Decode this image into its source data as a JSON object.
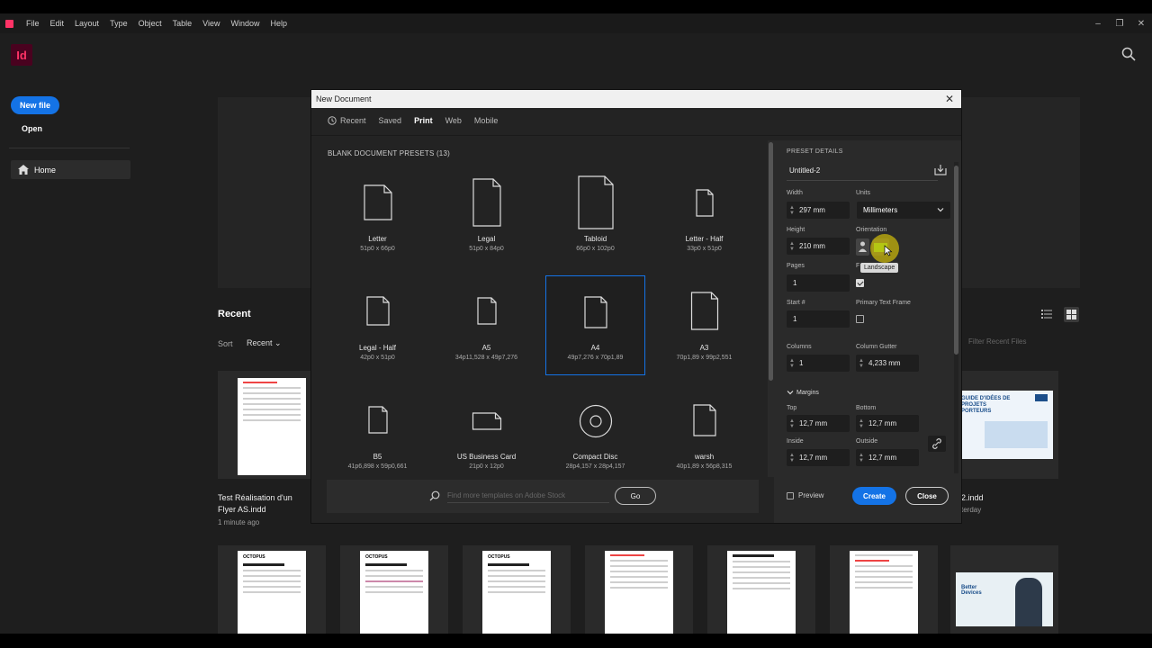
{
  "menubar": {
    "items": [
      "File",
      "Edit",
      "Layout",
      "Type",
      "Object",
      "Table",
      "View",
      "Window",
      "Help"
    ]
  },
  "appbar": {
    "logo": "Id"
  },
  "sidebar": {
    "new_file": "New file",
    "open": "Open",
    "home": "Home"
  },
  "home": {
    "recent_title": "Recent",
    "sort_label": "Sort",
    "sort_value": "Recent",
    "filter_placeholder": "Filter Recent Files",
    "files": [
      {
        "name": "Test Réalisation d'un Flyer AS.indd",
        "time": "1 minute ago"
      },
      {
        "name": "2.indd",
        "time": "terday"
      }
    ],
    "right_thumb_text": "GUIDE D'IDÉES DE PROJETS PORTEURS",
    "bottom_thumb_label": "Better Devices",
    "doc_headers": [
      "OCTOPUS",
      "OCTOPUS",
      "OCTOPUS"
    ]
  },
  "dialog": {
    "title": "New Document",
    "tabs": [
      "Recent",
      "Saved",
      "Print",
      "Web",
      "Mobile"
    ],
    "active_tab": "Print",
    "presets_header": "BLANK DOCUMENT PRESETS",
    "presets_count": "(13)",
    "presets": [
      {
        "name": "Letter",
        "size": "51p0 x 66p0"
      },
      {
        "name": "Legal",
        "size": "51p0 x 84p0"
      },
      {
        "name": "Tabloid",
        "size": "66p0 x 102p0"
      },
      {
        "name": "Letter - Half",
        "size": "33p0 x 51p0"
      },
      {
        "name": "Legal - Half",
        "size": "42p0 x 51p0"
      },
      {
        "name": "A5",
        "size": "34p11,528 x 49p7,276"
      },
      {
        "name": "A4",
        "size": "49p7,276 x 70p1,89"
      },
      {
        "name": "A3",
        "size": "70p1,89 x 99p2,551"
      },
      {
        "name": "B5",
        "size": "41p6,898 x 59p0,661"
      },
      {
        "name": "US Business Card",
        "size": "21p0 x 12p0"
      },
      {
        "name": "Compact Disc",
        "size": "28p4,157 x 28p4,157"
      },
      {
        "name": "warsh",
        "size": "40p1,89 x 56p8,315"
      }
    ],
    "stock_placeholder": "Find more templates on Adobe Stock",
    "go": "Go",
    "details": {
      "header": "PRESET DETAILS",
      "doc_name": "Untitled-2",
      "width_label": "Width",
      "width": "297 mm",
      "units_label": "Units",
      "units": "Millimeters",
      "height_label": "Height",
      "height": "210 mm",
      "orientation_label": "Orientation",
      "tooltip": "Landscape",
      "pages_label": "Pages",
      "pages": "1",
      "facing_label": "F",
      "start_label": "Start #",
      "start": "1",
      "primary_frame_label": "Primary Text Frame",
      "columns_label": "Columns",
      "columns": "1",
      "gutter_label": "Column Gutter",
      "gutter": "4,233 mm",
      "margins_label": "Margins",
      "top_label": "Top",
      "top": "12,7 mm",
      "bottom_label": "Bottom",
      "bottom": "12,7 mm",
      "inside_label": "Inside",
      "inside": "12,7 mm",
      "outside_label": "Outside",
      "outside": "12,7 mm"
    },
    "preview": "Preview",
    "create": "Create",
    "close": "Close"
  },
  "colors": {
    "accent": "#1473e6",
    "indesign": "#ff3366",
    "highlight": "#ffe600"
  }
}
